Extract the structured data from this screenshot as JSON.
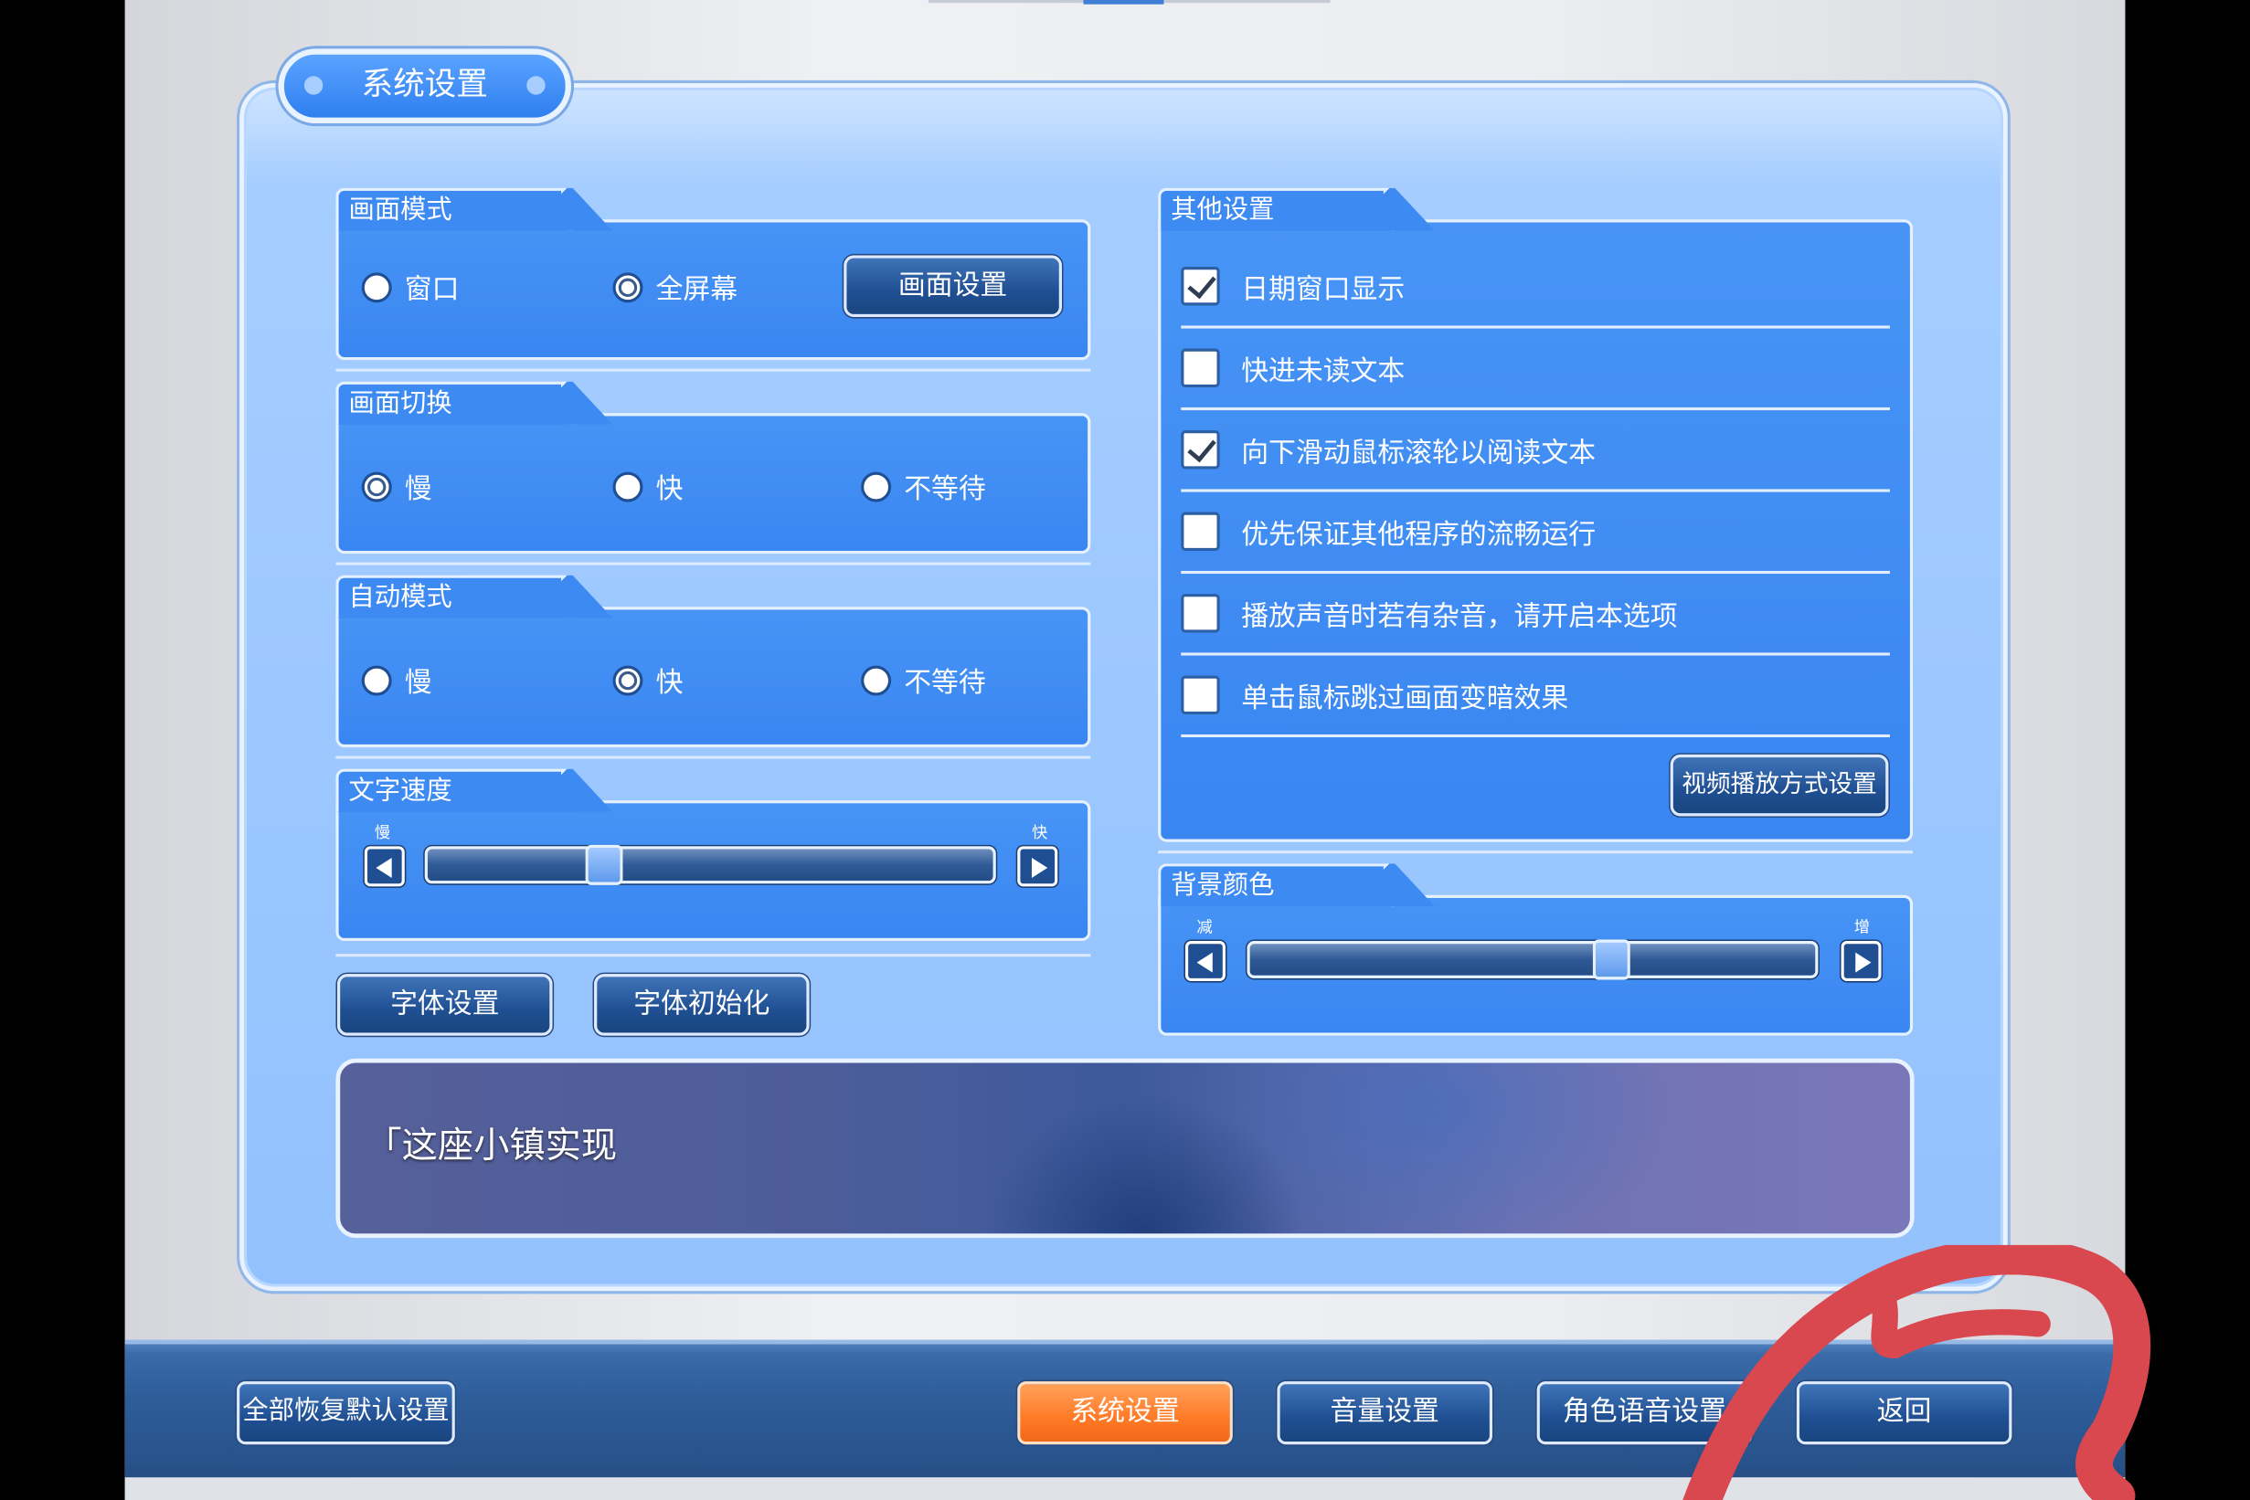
{
  "window": {
    "title": "系统设置"
  },
  "display_mode": {
    "title": "画面模式",
    "options": [
      "窗口",
      "全屏幕"
    ],
    "selected": 1,
    "settings_button": "画面设置"
  },
  "transition": {
    "title": "画面切换",
    "options": [
      "慢",
      "快",
      "不等待"
    ],
    "selected": 0
  },
  "auto_mode": {
    "title": "自动模式",
    "options": [
      "慢",
      "快",
      "不等待"
    ],
    "selected": 1
  },
  "text_speed": {
    "title": "文字速度",
    "min_label": "慢",
    "max_label": "快",
    "value": 0.3
  },
  "font_buttons": {
    "font_settings": "字体设置",
    "font_reset": "字体初始化"
  },
  "other_settings": {
    "title": "其他设置",
    "items": [
      {
        "label": "日期窗口显示",
        "checked": true
      },
      {
        "label": "快进未读文本",
        "checked": false
      },
      {
        "label": "向下滑动鼠标滚轮以阅读文本",
        "checked": true
      },
      {
        "label": "优先保证其他程序的流畅运行",
        "checked": false
      },
      {
        "label": "播放声音时若有杂音，请开启本选项",
        "checked": false
      },
      {
        "label": "单击鼠标跳过画面变暗效果",
        "checked": false
      }
    ],
    "video_button": "视频播放方式设置"
  },
  "background_color": {
    "title": "背景颜色",
    "min_label": "减",
    "max_label": "增",
    "value": 0.65
  },
  "preview_text": "「这座小镇实现",
  "bottom_bar": {
    "reset_all": "全部恢复默认设置",
    "system_settings": "系统设置",
    "volume_settings": "音量设置",
    "voice_settings": "角色语音设置",
    "back": "返回"
  },
  "colors": {
    "accent": "#3d8af3",
    "active_tab": "#ff7a26",
    "annotation": "#d9474f"
  }
}
